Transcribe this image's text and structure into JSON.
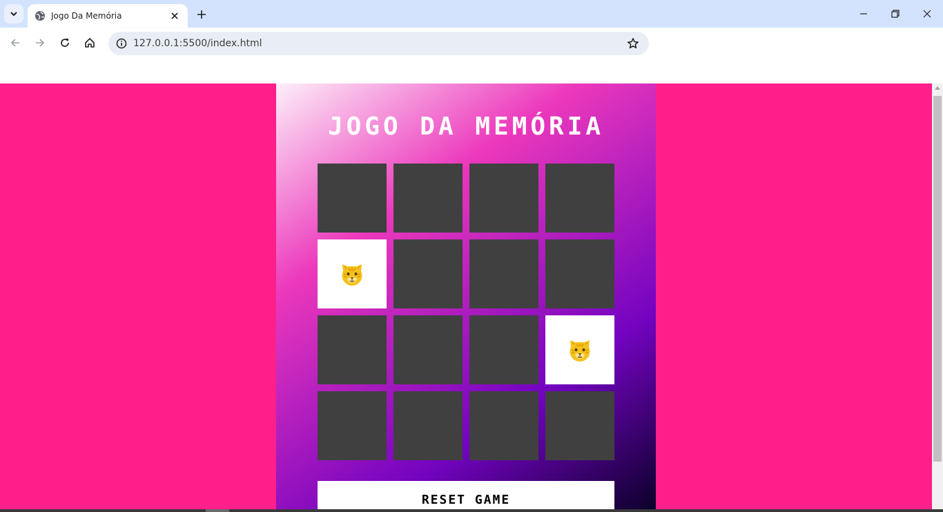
{
  "browser": {
    "tab_title": "Jogo Da Memória",
    "url": "127.0.0.1:5500/index.html"
  },
  "page": {
    "title": "JOGO DA MEMÓRIA",
    "reset_label": "RESET GAME",
    "colors": {
      "background": "#fe1f8b",
      "card_back": "#404040",
      "card_face": "#ffffff",
      "gradient": [
        "#03001e",
        "#7303c0",
        "#ec38bc",
        "#fdeff9"
      ]
    },
    "cards": [
      {
        "state": "hidden",
        "icon": ""
      },
      {
        "state": "hidden",
        "icon": ""
      },
      {
        "state": "hidden",
        "icon": ""
      },
      {
        "state": "hidden",
        "icon": ""
      },
      {
        "state": "flipped",
        "icon": "tiger-face-icon"
      },
      {
        "state": "hidden",
        "icon": ""
      },
      {
        "state": "hidden",
        "icon": ""
      },
      {
        "state": "hidden",
        "icon": ""
      },
      {
        "state": "hidden",
        "icon": ""
      },
      {
        "state": "hidden",
        "icon": ""
      },
      {
        "state": "hidden",
        "icon": ""
      },
      {
        "state": "flipped",
        "icon": "tiger-face-icon"
      },
      {
        "state": "hidden",
        "icon": ""
      },
      {
        "state": "hidden",
        "icon": ""
      },
      {
        "state": "hidden",
        "icon": ""
      },
      {
        "state": "hidden",
        "icon": ""
      }
    ]
  }
}
